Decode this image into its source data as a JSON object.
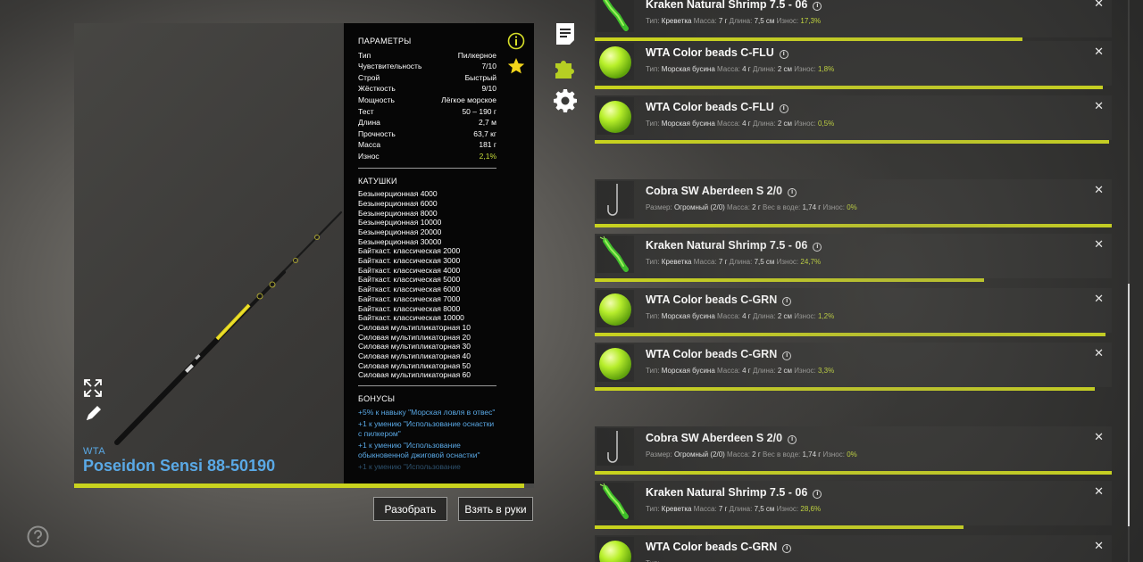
{
  "rod": {
    "brand": "WTA",
    "name": "Poseidon Sensi 88-50190",
    "condition_fraction": 0.979
  },
  "params": {
    "title": "ПАРАМЕТРЫ",
    "rows": [
      {
        "k": "Тип",
        "v": "Пилкерное"
      },
      {
        "k": "Чувствительность",
        "v": "7/10"
      },
      {
        "k": "Строй",
        "v": "Быстрый"
      },
      {
        "k": "Жёсткость",
        "v": "9/10"
      },
      {
        "k": "Мощность",
        "v": "Лёгкое морское"
      },
      {
        "k": "Тест",
        "v": "50 – 190 г"
      },
      {
        "k": "Длина",
        "v": "2,7 м"
      },
      {
        "k": "Прочность",
        "v": "63,7 кг"
      },
      {
        "k": "Масса",
        "v": "181 г"
      },
      {
        "k": "Износ",
        "v": "2,1%"
      }
    ]
  },
  "reels": {
    "title": "КАТУШКИ",
    "items": [
      "Безынерционная 4000",
      "Безынерционная 6000",
      "Безынерционная 8000",
      "Безынерционная 10000",
      "Безынерционная 20000",
      "Безынерционная 30000",
      "Байткаст. классическая 2000",
      "Байткаст. классическая 3000",
      "Байткаст. классическая 4000",
      "Байткаст. классическая 5000",
      "Байткаст. классическая 6000",
      "Байткаст. классическая 7000",
      "Байткаст. классическая 8000",
      "Байткаст. классическая 10000",
      "Силовая мультипликаторная 10",
      "Силовая мультипликаторная 20",
      "Силовая мультипликаторная 30",
      "Силовая мультипликаторная 40",
      "Силовая мультипликаторная 50",
      "Силовая мультипликаторная 60"
    ]
  },
  "bonuses": {
    "title": "БОНУСЫ",
    "items": [
      "+5% к навыку \"Морская ловля в отвес\"",
      "+1 к умению \"Использование оснастки с пилкером\"",
      "+1 к умению \"Использование обыкновенной джиговой оснастки\"",
      "+1 к умению \"Использование"
    ]
  },
  "buttons": {
    "disassemble": "Разобрать",
    "take": "Взять в руки"
  },
  "colors": {
    "accent": "#c9d31e",
    "brand_blue": "#5aa9e6",
    "star": "#f2d41a",
    "wear": "#c7dc3a"
  },
  "list": {
    "items": [
      {
        "kind": "shrimp",
        "title": "Kraken Natural Shrimp 7.5 - 06",
        "l1": "Тип:",
        "v1": "Креветка",
        "l2": "Масса:",
        "v2": "7 г",
        "l3": "Длина:",
        "v3": "7,5 см",
        "l4": "Износ:",
        "v4": "17,3%",
        "fill": 0.827
      },
      {
        "kind": "bead",
        "title": "WTA Color beads C-FLU",
        "l1": "Тип:",
        "v1": "Морская бусина",
        "l2": "Масса:",
        "v2": "4 г",
        "l3": "Длина:",
        "v3": "2 см",
        "l4": "Износ:",
        "v4": "1,8%",
        "fill": 0.982
      },
      {
        "kind": "bead",
        "title": "WTA Color beads C-FLU",
        "l1": "Тип:",
        "v1": "Морская бусина",
        "l2": "Масса:",
        "v2": "4 г",
        "l3": "Длина:",
        "v3": "2 см",
        "l4": "Износ:",
        "v4": "0,5%",
        "fill": 0.995
      },
      {
        "kind": "hook",
        "title": "Cobra SW Aberdeen S 2/0",
        "l1": "Размер:",
        "v1": "Огромный (2/0)",
        "l2": "Масса:",
        "v2": "2 г",
        "l3": "Вес в воде:",
        "v3": "1,74 г",
        "l4": "Износ:",
        "v4": "0%",
        "fill": 1.0
      },
      {
        "kind": "shrimp",
        "title": "Kraken Natural Shrimp 7.5 - 06",
        "l1": "Тип:",
        "v1": "Креветка",
        "l2": "Масса:",
        "v2": "7 г",
        "l3": "Длина:",
        "v3": "7,5 см",
        "l4": "Износ:",
        "v4": "24,7%",
        "fill": 0.753
      },
      {
        "kind": "bead",
        "title": "WTA Color beads C-GRN",
        "l1": "Тип:",
        "v1": "Морская бусина",
        "l2": "Масса:",
        "v2": "4 г",
        "l3": "Длина:",
        "v3": "2 см",
        "l4": "Износ:",
        "v4": "1,2%",
        "fill": 0.988
      },
      {
        "kind": "bead",
        "title": "WTA Color beads C-GRN",
        "l1": "Тип:",
        "v1": "Морская бусина",
        "l2": "Масса:",
        "v2": "4 г",
        "l3": "Длина:",
        "v3": "2 см",
        "l4": "Износ:",
        "v4": "3,3%",
        "fill": 0.967
      },
      {
        "kind": "hook",
        "title": "Cobra SW Aberdeen S 2/0",
        "l1": "Размер:",
        "v1": "Огромный (2/0)",
        "l2": "Масса:",
        "v2": "2 г",
        "l3": "Вес в воде:",
        "v3": "1,74 г",
        "l4": "Износ:",
        "v4": "0%",
        "fill": 1.0
      },
      {
        "kind": "shrimp",
        "title": "Kraken Natural Shrimp 7.5 - 06",
        "l1": "Тип:",
        "v1": "Креветка",
        "l2": "Масса:",
        "v2": "7 г",
        "l3": "Длина:",
        "v3": "7,5 см",
        "l4": "Износ:",
        "v4": "28,6%",
        "fill": 0.714
      },
      {
        "kind": "bead",
        "title": "WTA Color beads C-GRN",
        "l1": "Тип:",
        "v1": "",
        "l2": "",
        "v2": "",
        "l3": "",
        "v3": "",
        "l4": "",
        "v4": "",
        "fill": 1.0
      }
    ]
  },
  "icons": {
    "info": "info-icon",
    "favorite": "star-icon",
    "notes": "document-icon",
    "addons": "puzzle-icon",
    "settings": "gear-icon",
    "expand": "expand-icon",
    "edit": "pen-icon",
    "help": "help-icon",
    "close": "close-icon"
  }
}
